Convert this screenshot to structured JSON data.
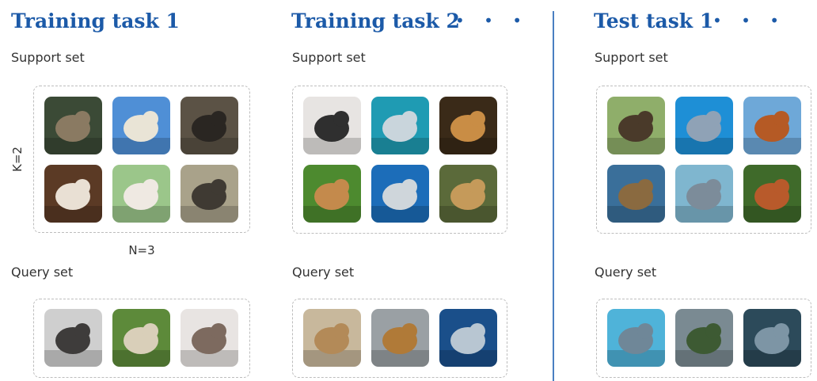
{
  "columns": [
    {
      "title": "Training task 1",
      "show_dots": false,
      "support_label": "Support set",
      "query_label": "Query set",
      "support_images": [
        {
          "name": "cat-image",
          "bg": "#3b4a36",
          "fg": "#8a7a62"
        },
        {
          "name": "lamb-image",
          "bg": "#4f8fd6",
          "fg": "#e9e4d6"
        },
        {
          "name": "boar-image",
          "bg": "#5b5245",
          "fg": "#2a2622"
        },
        {
          "name": "cat-image",
          "bg": "#5b3a25",
          "fg": "#e9e0d4"
        },
        {
          "name": "lamb-image",
          "bg": "#9bc68a",
          "fg": "#efe9e2"
        },
        {
          "name": "warthog-image",
          "bg": "#a9a28a",
          "fg": "#3f3a33"
        }
      ],
      "query_images": [
        {
          "name": "pig-image",
          "bg": "#cfcfcf",
          "fg": "#3e3c3b"
        },
        {
          "name": "sheep-image",
          "bg": "#5d8a3a",
          "fg": "#d9cfb9"
        },
        {
          "name": "cat-image",
          "bg": "#e8e4e2",
          "fg": "#7d6a5f"
        }
      ]
    },
    {
      "title": "Training task 2",
      "show_dots": true,
      "support_label": "Support set",
      "query_label": "Query set",
      "support_images": [
        {
          "name": "husky-image",
          "bg": "#e7e4e2",
          "fg": "#2f2f2f"
        },
        {
          "name": "shark-image",
          "bg": "#1f9bb3",
          "fg": "#c9d5dc"
        },
        {
          "name": "lion-image",
          "bg": "#3a2a18",
          "fg": "#c98d45"
        },
        {
          "name": "dog-image",
          "bg": "#4d8a2f",
          "fg": "#c48a4c"
        },
        {
          "name": "shark-image",
          "bg": "#1c6db9",
          "fg": "#cfd6db"
        },
        {
          "name": "lion-cub-image",
          "bg": "#5b6a3a",
          "fg": "#c59a5a"
        }
      ],
      "query_images": [
        {
          "name": "lioness-image",
          "bg": "#c8b89c",
          "fg": "#b38a58"
        },
        {
          "name": "lion-image",
          "bg": "#9aa0a4",
          "fg": "#b07a38"
        },
        {
          "name": "shark-image",
          "bg": "#1a4f8a",
          "fg": "#b8c6d2"
        }
      ]
    },
    {
      "title": "Test task 1",
      "show_dots": true,
      "support_label": "Support set",
      "query_label": "Query set",
      "support_images": [
        {
          "name": "duck-image",
          "bg": "#8fae6a",
          "fg": "#4a3a2a"
        },
        {
          "name": "dolphin-image",
          "bg": "#1e8fd6",
          "fg": "#8fa2b6"
        },
        {
          "name": "hen-image",
          "bg": "#6ea8d8",
          "fg": "#b55a25"
        },
        {
          "name": "duck-image",
          "bg": "#3a6f9a",
          "fg": "#8a6a40"
        },
        {
          "name": "dolphin-image",
          "bg": "#7fb6cf",
          "fg": "#7c8c9a"
        },
        {
          "name": "hen-image",
          "bg": "#3f6a2a",
          "fg": "#b85a2b"
        }
      ],
      "query_images": [
        {
          "name": "dolphin-image",
          "bg": "#4fb3d9",
          "fg": "#6f8798"
        },
        {
          "name": "duck-image",
          "bg": "#7a8a92",
          "fg": "#3d5a33"
        },
        {
          "name": "dolphin-image",
          "bg": "#2c4a5a",
          "fg": "#7d95a5"
        }
      ]
    }
  ],
  "dots_text": "• • •",
  "k_label": "K=2",
  "n_label": "N=3",
  "colors": {
    "title": "#1c5aa8",
    "divider": "#4a7fc1",
    "box_border": "#bdbdbd"
  }
}
